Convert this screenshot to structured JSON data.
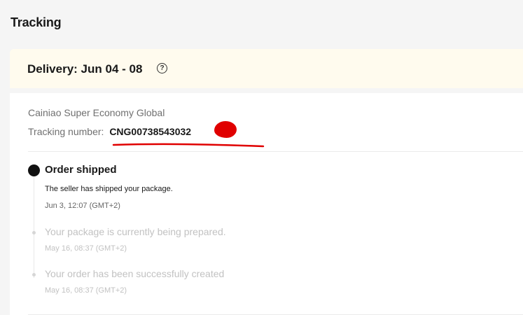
{
  "page": {
    "title": "Tracking"
  },
  "delivery": {
    "text": "Delivery: Jun 04 - 08",
    "help_glyph": "?"
  },
  "shipment": {
    "carrier": "Cainiao Super Economy Global",
    "tracking_label": "Tracking number:",
    "tracking_number": "CNG00738543032"
  },
  "events": [
    {
      "title": "Order shipped",
      "description": "The seller has shipped your package.",
      "time": "Jun 3, 12:07 (GMT+2)",
      "status": "active"
    },
    {
      "title": "Your package is currently being prepared.",
      "time": "May 16, 08:37 (GMT+2)",
      "status": "past"
    },
    {
      "title": "Your order has been successfully created",
      "time": "May 16, 08:37 (GMT+2)",
      "status": "past"
    }
  ],
  "colors": {
    "background": "#f5f5f5",
    "banner": "#fffbee",
    "card": "#ffffff",
    "active_dot": "#111111",
    "annotation_red": "#e00000",
    "muted_text": "#c2c2c2"
  }
}
